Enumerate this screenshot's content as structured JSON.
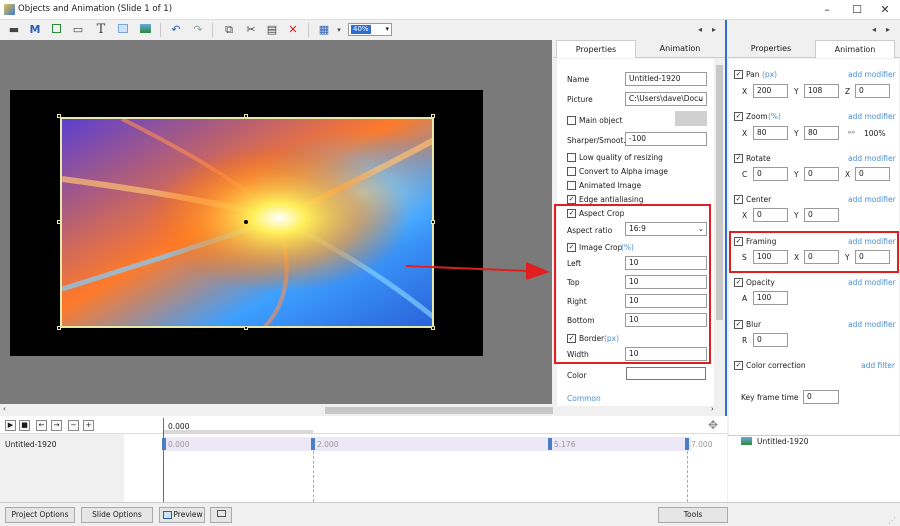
{
  "window": {
    "title": "Objects and Animation (Slide 1 of 1)",
    "zoom": "40%"
  },
  "canvas": {
    "tabs_nav": [
      "◂",
      "▸"
    ]
  },
  "properties": {
    "tabs": [
      "Properties",
      "Animation"
    ],
    "name_label": "Name",
    "name_value": "Untitled-1920",
    "picture_label": "Picture",
    "picture_value": "C:\\Users\\dave\\Docu",
    "main_object_label": "Main object",
    "sharper_label": "Sharper/Smoot...",
    "sharper_value": "-100",
    "low_quality_label": "Low quality of resizing",
    "convert_alpha_label": "Convert to Alpha image",
    "animated_image_label": "Animated Image",
    "edge_antialias_label": "Edge antialiasing",
    "aspect_crop_label": "Aspect Crop",
    "aspect_ratio_label": "Aspect ratio",
    "aspect_ratio_value": "16:9",
    "image_crop_label": "Image Crop",
    "image_crop_unit": "(%)",
    "left_label": "Left",
    "left_value": "10",
    "top_label": "Top",
    "top_value": "10",
    "right_label": "Right",
    "right_value": "10",
    "bottom_label": "Bottom",
    "bottom_value": "10",
    "border_label": "Border",
    "border_unit": "(px)",
    "width_label": "Width",
    "width_value": "10",
    "color_label": "Color",
    "common_label": "Common"
  },
  "animation": {
    "tabs": [
      "Properties",
      "Animation"
    ],
    "add_modifier": "add modifier",
    "add_filter": "add filter",
    "pan": {
      "label": "Pan",
      "unit": "(px)",
      "x": "200",
      "y": "108",
      "z": "0"
    },
    "zoom": {
      "label": "Zoom",
      "unit": "(%)",
      "x": "80",
      "y": "80",
      "link": "100%"
    },
    "rotate": {
      "label": "Rotate",
      "c": "0",
      "y": "0",
      "x": "0"
    },
    "center": {
      "label": "Center",
      "x": "0",
      "y": "0"
    },
    "framing": {
      "label": "Framing",
      "s": "100",
      "x": "0",
      "y": "0"
    },
    "opacity": {
      "label": "Opacity",
      "a": "100"
    },
    "blur": {
      "label": "Blur",
      "r": "0"
    },
    "color_correction": {
      "label": "Color correction"
    },
    "key_frame_label": "Key frame time",
    "key_frame_value": "0",
    "axis": {
      "X": "X",
      "Y": "Y",
      "Z": "Z",
      "C": "C",
      "S": "S",
      "A": "A",
      "R": "R"
    },
    "object_item": "Untitled-1920"
  },
  "timeline": {
    "ruler_start": "0.000",
    "object_name": "Untitled-1920",
    "keyframes": [
      "0.000",
      "2.000",
      "5.176",
      "7.000"
    ]
  },
  "footer": {
    "project_options": "Project Options",
    "slide_options": "Slide Options",
    "preview": "Preview",
    "tools": "Tools"
  }
}
